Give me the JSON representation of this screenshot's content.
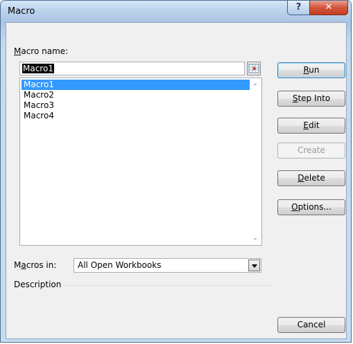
{
  "window": {
    "title": "Macro",
    "help_glyph": "?",
    "close_glyph": "✕"
  },
  "form": {
    "macro_name_label_pre": "",
    "macro_name_label_ul": "M",
    "macro_name_label_post": "acro name:",
    "macro_name_value": "Macro1",
    "macros_in_label_pre": "M",
    "macros_in_label_ul": "a",
    "macros_in_label_post": "cros in:",
    "macros_in_value": "All Open Workbooks",
    "description_label": "Description"
  },
  "macros": [
    {
      "label": "Macro1",
      "selected": true
    },
    {
      "label": "Macro2",
      "selected": false
    },
    {
      "label": "Macro3",
      "selected": false
    },
    {
      "label": "Macro4",
      "selected": false
    }
  ],
  "buttons": {
    "run": {
      "ul": "R",
      "rest": "un"
    },
    "step_into": {
      "ul": "S",
      "rest": "tep Into"
    },
    "edit": {
      "ul": "E",
      "rest": "dit"
    },
    "create": {
      "label": "Create",
      "enabled": false
    },
    "delete": {
      "ul": "D",
      "rest": "elete"
    },
    "options": {
      "ul": "O",
      "rest": "ptions..."
    },
    "cancel": {
      "label": "Cancel"
    }
  },
  "colors": {
    "selection": "#3399ff",
    "title_bar": "#bcd3ec",
    "close_button": "#c53b20"
  },
  "icons": {
    "help": "question-mark",
    "close": "x",
    "collapse_dialog": "range-select",
    "dropdown": "triangle-down"
  }
}
